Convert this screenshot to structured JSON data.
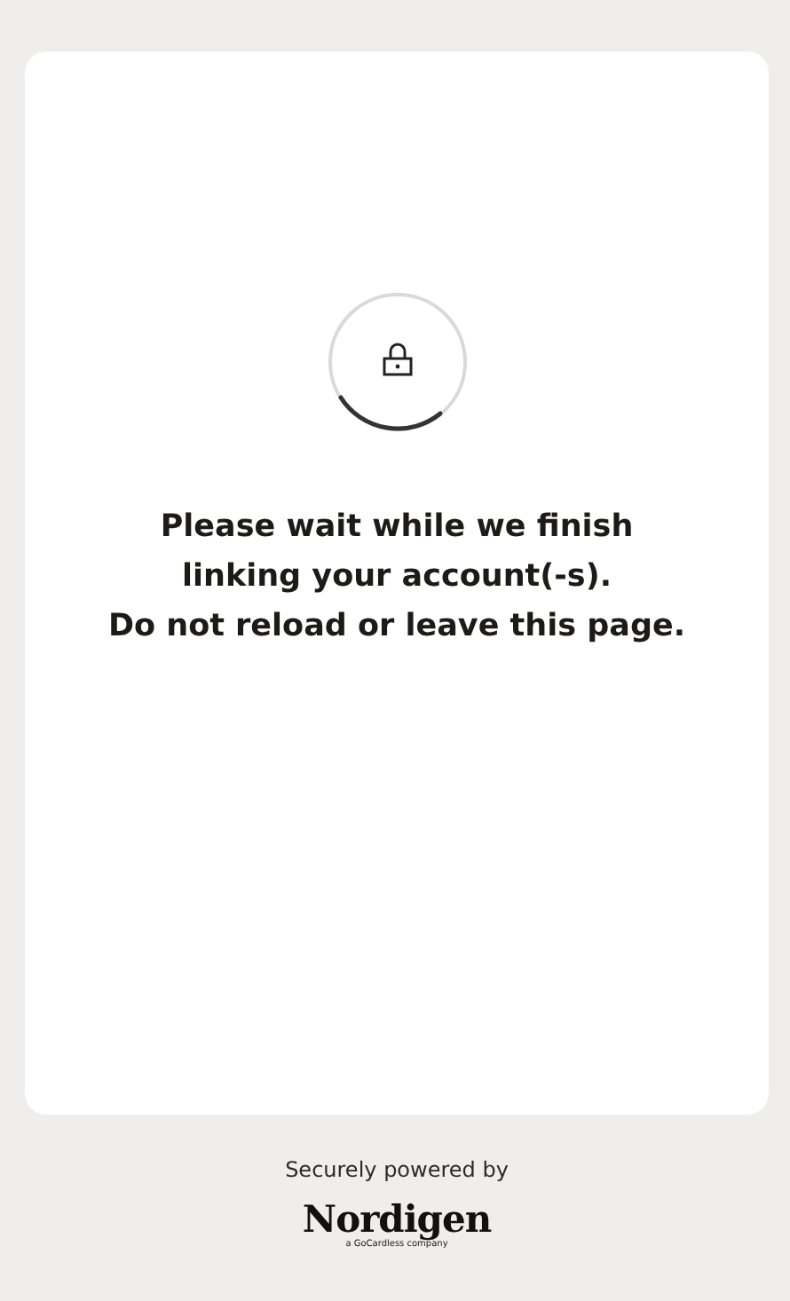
{
  "message": [
    "Please wait while we finish",
    "linking your account(-s).",
    "Do not reload or leave this page."
  ],
  "footer": {
    "caption": "Securely powered by",
    "brand": "Nordigen",
    "tagline": "a GoCardless company"
  }
}
